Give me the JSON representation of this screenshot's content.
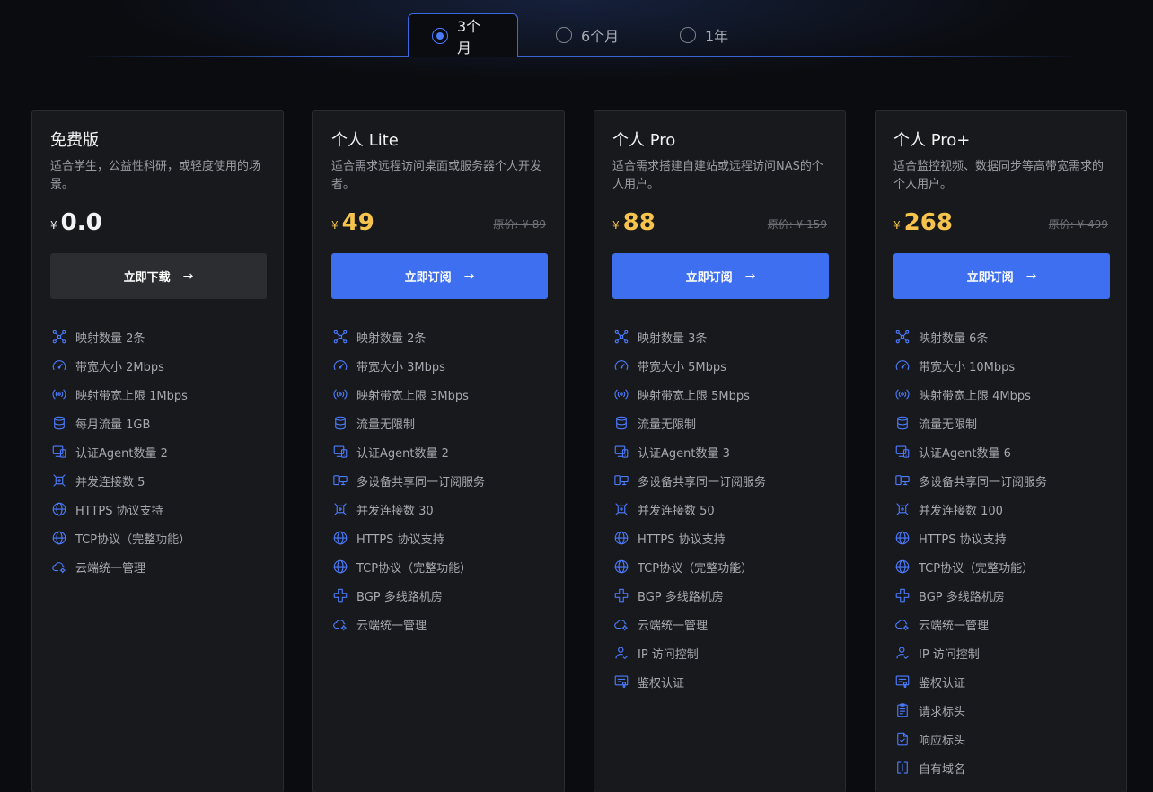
{
  "theme": {
    "accent": "#3d6ff0",
    "price_color": "#f6c44c"
  },
  "tabs": [
    {
      "label": "3个月",
      "selected": true
    },
    {
      "label": "6个月",
      "selected": false
    },
    {
      "label": "1年",
      "selected": false
    }
  ],
  "plans": [
    {
      "title": "免费版",
      "desc": "适合学生，公益性科研，或轻度使用的场景。",
      "currency": "¥",
      "price": "0.0",
      "original": "",
      "cta": "立即下载",
      "cta_style": "secondary",
      "features": [
        {
          "icon": "mapping-icon",
          "text": "映射数量 2条"
        },
        {
          "icon": "speedometer-icon",
          "text": "带宽大小 2Mbps"
        },
        {
          "icon": "broadcast-icon",
          "text": "映射带宽上限 1Mbps"
        },
        {
          "icon": "database-icon",
          "text": "每月流量 1GB"
        },
        {
          "icon": "devices-icon",
          "text": "认证Agent数量 2"
        },
        {
          "icon": "connection-icon",
          "text": "并发连接数 5"
        },
        {
          "icon": "globe-icon",
          "text": "HTTPS 协议支持"
        },
        {
          "icon": "globe-icon",
          "text": "TCP协议（完整功能）"
        },
        {
          "icon": "cloud-gear-icon",
          "text": "云端统一管理"
        }
      ]
    },
    {
      "title": "个人 Lite",
      "desc": "适合需求远程访问桌面或服务器个人开发者。",
      "currency": "¥",
      "price": "49",
      "original": "原价: ¥ 89",
      "cta": "立即订阅",
      "cta_style": "primary",
      "features": [
        {
          "icon": "mapping-icon",
          "text": "映射数量 2条"
        },
        {
          "icon": "speedometer-icon",
          "text": "带宽大小 3Mbps"
        },
        {
          "icon": "broadcast-icon",
          "text": "映射带宽上限 3Mbps"
        },
        {
          "icon": "database-icon",
          "text": "流量无限制"
        },
        {
          "icon": "devices-icon",
          "text": "认证Agent数量 2"
        },
        {
          "icon": "multi-device-icon",
          "text": "多设备共享同一订阅服务"
        },
        {
          "icon": "connection-icon",
          "text": "并发连接数 30"
        },
        {
          "icon": "globe-icon",
          "text": "HTTPS 协议支持"
        },
        {
          "icon": "globe-icon",
          "text": "TCP协议（完整功能）"
        },
        {
          "icon": "network-icon",
          "text": "BGP 多线路机房"
        },
        {
          "icon": "cloud-gear-icon",
          "text": "云端统一管理"
        }
      ]
    },
    {
      "title": "个人 Pro",
      "desc": "适合需求搭建自建站或远程访问NAS的个人用户。",
      "currency": "¥",
      "price": "88",
      "original": "原价: ¥ 159",
      "cta": "立即订阅",
      "cta_style": "primary",
      "features": [
        {
          "icon": "mapping-icon",
          "text": "映射数量 3条"
        },
        {
          "icon": "speedometer-icon",
          "text": "带宽大小 5Mbps"
        },
        {
          "icon": "broadcast-icon",
          "text": "映射带宽上限 5Mbps"
        },
        {
          "icon": "database-icon",
          "text": "流量无限制"
        },
        {
          "icon": "devices-icon",
          "text": "认证Agent数量 3"
        },
        {
          "icon": "multi-device-icon",
          "text": "多设备共享同一订阅服务"
        },
        {
          "icon": "connection-icon",
          "text": "并发连接数 50"
        },
        {
          "icon": "globe-icon",
          "text": "HTTPS 协议支持"
        },
        {
          "icon": "globe-icon",
          "text": "TCP协议（完整功能）"
        },
        {
          "icon": "network-icon",
          "text": "BGP 多线路机房"
        },
        {
          "icon": "cloud-gear-icon",
          "text": "云端统一管理"
        },
        {
          "icon": "user-check-icon",
          "text": "IP 访问控制"
        },
        {
          "icon": "certificate-icon",
          "text": "鉴权认证"
        }
      ]
    },
    {
      "title": "个人 Pro+",
      "desc": "适合监控视频、数据同步等高带宽需求的个人用户。",
      "currency": "¥",
      "price": "268",
      "original": "原价: ¥ 499",
      "cta": "立即订阅",
      "cta_style": "primary",
      "features": [
        {
          "icon": "mapping-icon",
          "text": "映射数量 6条"
        },
        {
          "icon": "speedometer-icon",
          "text": "带宽大小 10Mbps"
        },
        {
          "icon": "broadcast-icon",
          "text": "映射带宽上限 4Mbps"
        },
        {
          "icon": "database-icon",
          "text": "流量无限制"
        },
        {
          "icon": "devices-icon",
          "text": "认证Agent数量 6"
        },
        {
          "icon": "multi-device-icon",
          "text": "多设备共享同一订阅服务"
        },
        {
          "icon": "connection-icon",
          "text": "并发连接数 100"
        },
        {
          "icon": "globe-icon",
          "text": "HTTPS 协议支持"
        },
        {
          "icon": "globe-icon",
          "text": "TCP协议（完整功能）"
        },
        {
          "icon": "network-icon",
          "text": "BGP 多线路机房"
        },
        {
          "icon": "cloud-gear-icon",
          "text": "云端统一管理"
        },
        {
          "icon": "user-check-icon",
          "text": "IP 访问控制"
        },
        {
          "icon": "certificate-icon",
          "text": "鉴权认证"
        },
        {
          "icon": "clipboard-icon",
          "text": "请求标头"
        },
        {
          "icon": "file-check-icon",
          "text": "响应标头"
        },
        {
          "icon": "domain-icon",
          "text": "自有域名"
        }
      ]
    }
  ]
}
